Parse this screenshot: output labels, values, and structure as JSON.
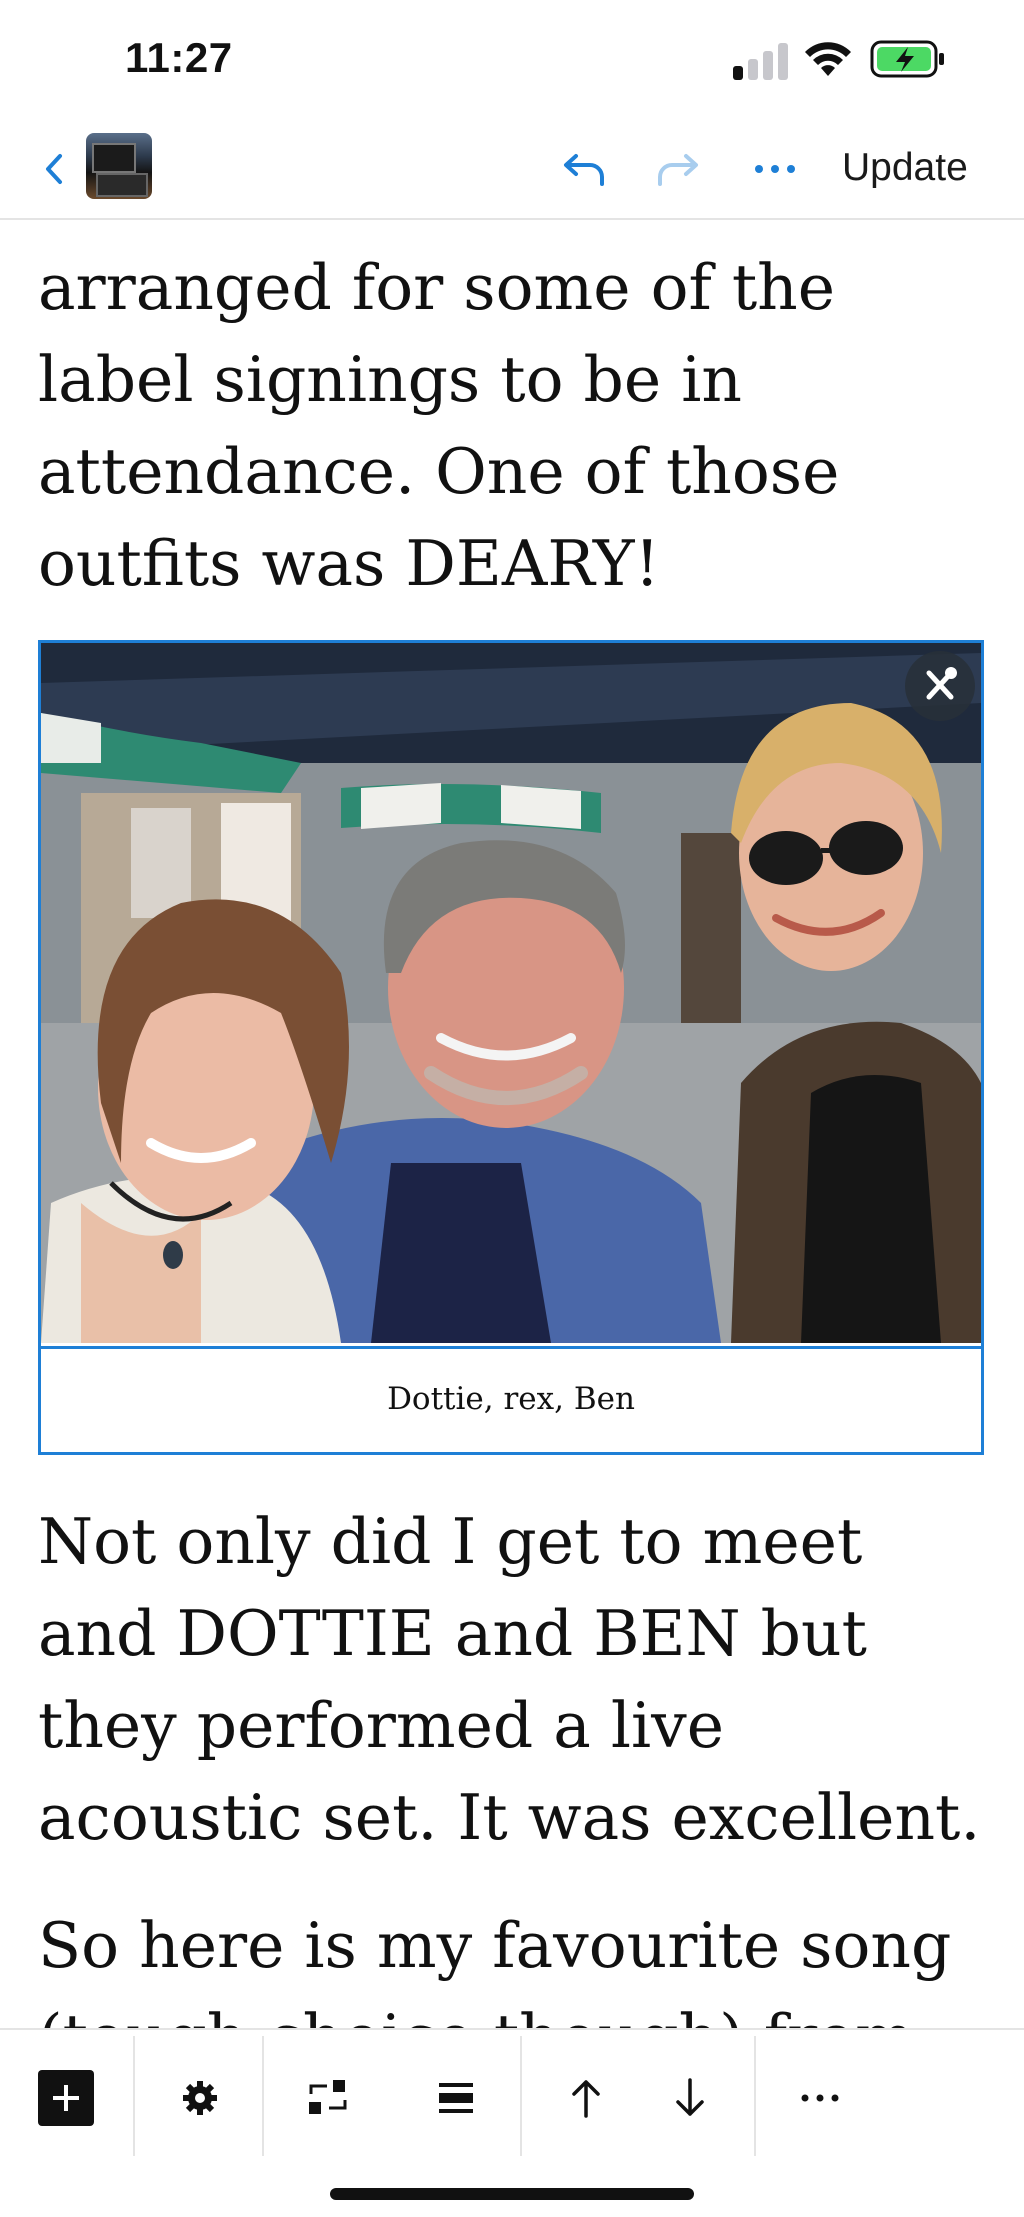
{
  "status_bar": {
    "time": "11:27"
  },
  "toolbar": {
    "update_label": "Update"
  },
  "content": {
    "paragraph_1": "arranged for some of the label signings to be in attendance.  One of those outfits was DEARY!",
    "image_caption": "Dottie, rex, Ben",
    "paragraph_2": "Not only did I get to meet and DOTTIE and BEN but they performed a live acoustic set. It was excellent.",
    "paragraph_3": "So here is my favourite song (tough choice though) from"
  },
  "icons": {
    "back": "chevron-left-icon",
    "undo": "undo-icon",
    "redo": "redo-icon",
    "more": "more-icon",
    "block_settings": "tools-icon",
    "add": "plus-icon",
    "settings": "gear-icon",
    "transform": "transform-icon",
    "align": "align-icon",
    "move_up": "arrow-up-icon",
    "move_down": "arrow-down-icon",
    "overflow": "ellipsis-icon"
  },
  "colors": {
    "accent": "#1e7fd6",
    "battery": "#4cd964"
  }
}
